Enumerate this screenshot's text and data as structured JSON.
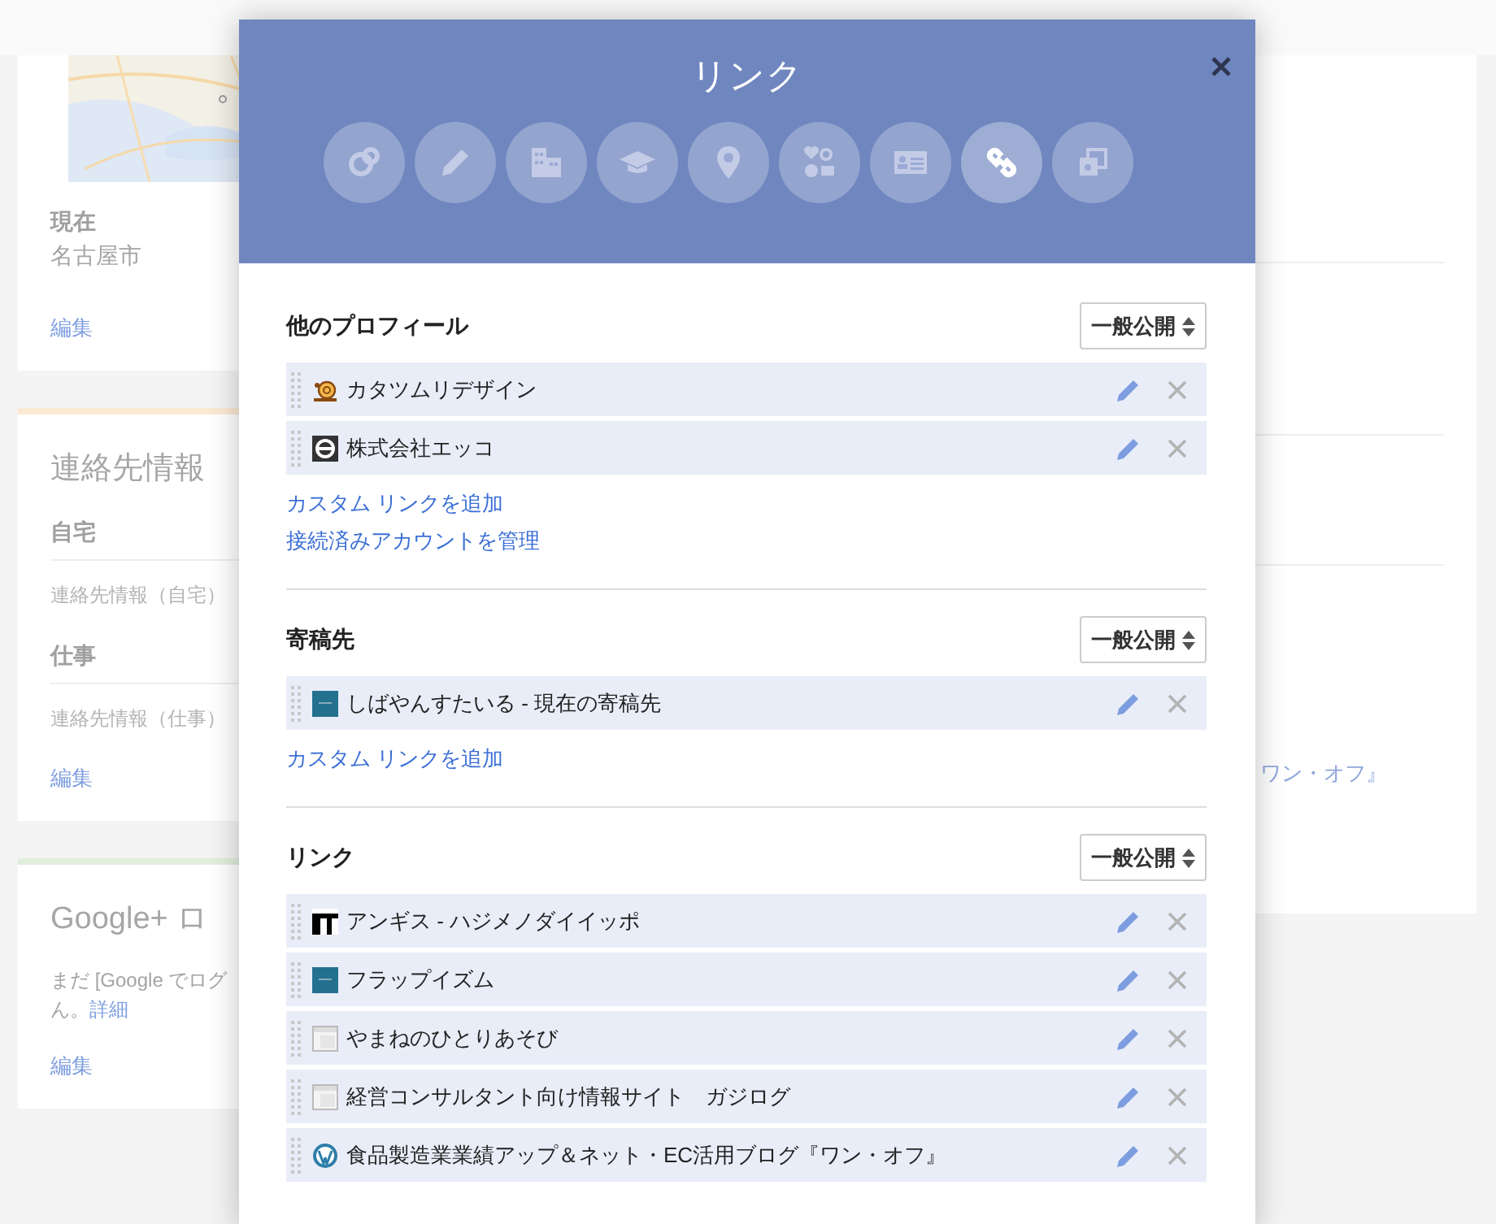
{
  "background": {
    "location_card": {
      "heading": "現在",
      "value": "名古屋市",
      "edit_link": "編集"
    },
    "contact_card": {
      "title": "連絡先情報",
      "sections": [
        {
          "heading": "自宅",
          "hint": "連絡先情報（自宅）"
        },
        {
          "heading": "仕事",
          "hint": "連絡先情報（仕事）"
        }
      ],
      "edit_link": "編集"
    },
    "login_card": {
      "title": "Google+ ロ",
      "text": "まだ [Google でログ",
      "text_2": "ん。",
      "detail_link": "詳細",
      "edit_link": "編集"
    },
    "right_card": {
      "fragment": "ワン・オフ』"
    }
  },
  "dialog": {
    "title": "リンク",
    "tabs": [
      {
        "selected": false
      },
      {
        "selected": false
      },
      {
        "selected": false
      },
      {
        "selected": false
      },
      {
        "selected": false
      },
      {
        "selected": false
      },
      {
        "selected": false
      },
      {
        "selected": true
      },
      {
        "selected": false
      }
    ],
    "sections": [
      {
        "title": "他のプロフィール",
        "visibility": "一般公開",
        "items": [
          {
            "label": "カタツムリデザイン"
          },
          {
            "label": "株式会社エッコ"
          }
        ],
        "links": [
          "カスタム リンクを追加",
          "接続済みアカウントを管理"
        ]
      },
      {
        "title": "寄稿先",
        "visibility": "一般公開",
        "items": [
          {
            "label": "しばやんすたいる - 現在の寄稿先"
          }
        ],
        "links": [
          "カスタム リンクを追加"
        ]
      },
      {
        "title": "リンク",
        "visibility": "一般公開",
        "items": [
          {
            "label": "アンギス - ハジメノダイイッポ"
          },
          {
            "label": "フラップイズム"
          },
          {
            "label": "やまねのひとりあそび"
          },
          {
            "label": "経営コンサルタント向け情報サイト　ガジログ"
          },
          {
            "label": "食品製造業業績アップ＆ネット・EC活用ブログ『ワン・オフ』"
          }
        ]
      }
    ]
  }
}
